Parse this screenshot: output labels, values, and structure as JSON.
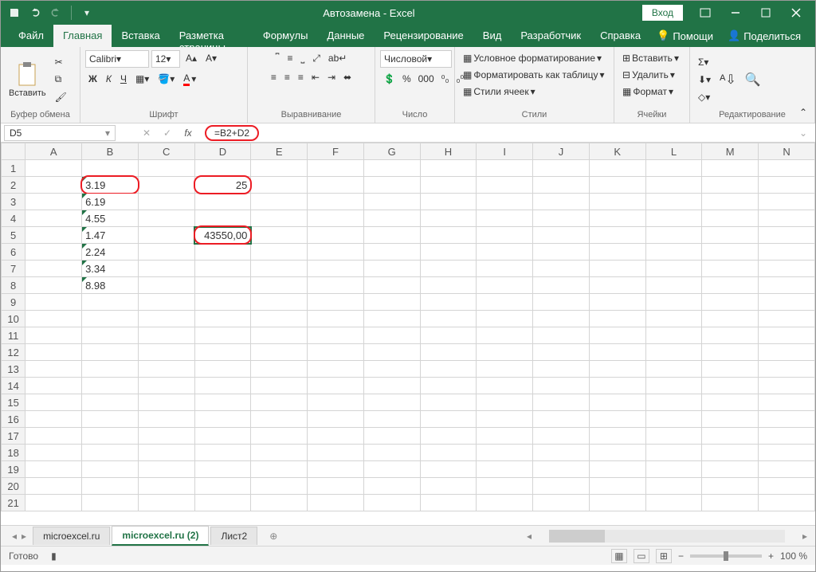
{
  "titlebar": {
    "title": "Автозамена - Excel",
    "signin": "Вход"
  },
  "tabs": {
    "file": "Файл",
    "home": "Главная",
    "insert": "Вставка",
    "layout": "Разметка страницы",
    "formulas": "Формулы",
    "data": "Данные",
    "review": "Рецензирование",
    "view": "Вид",
    "developer": "Разработчик",
    "help": "Справка",
    "tellme": "Помощи",
    "share": "Поделиться"
  },
  "ribbon": {
    "clipboard": {
      "label": "Буфер обмена",
      "paste": "Вставить"
    },
    "font": {
      "label": "Шрифт",
      "name": "Calibri",
      "size": "12",
      "bold": "Ж",
      "italic": "К",
      "underline": "Ч"
    },
    "align": {
      "label": "Выравнивание"
    },
    "number": {
      "label": "Число",
      "format": "Числовой"
    },
    "styles": {
      "label": "Стили",
      "cond": "Условное форматирование",
      "table": "Форматировать как таблицу",
      "cell": "Стили ячеек"
    },
    "cells": {
      "label": "Ячейки",
      "insert": "Вставить",
      "delete": "Удалить",
      "format": "Формат"
    },
    "editing": {
      "label": "Редактирование"
    }
  },
  "formula_bar": {
    "cell_ref": "D5",
    "formula": "=B2+D2"
  },
  "grid": {
    "columns": [
      "A",
      "B",
      "C",
      "D",
      "E",
      "F",
      "G",
      "H",
      "I",
      "J",
      "K",
      "L",
      "M",
      "N"
    ],
    "rows": [
      1,
      2,
      3,
      4,
      5,
      6,
      7,
      8,
      9,
      10,
      11,
      12,
      13,
      14,
      15,
      16,
      17,
      18,
      19,
      20,
      21
    ],
    "cells": {
      "B2": "3.19",
      "B3": "6.19",
      "B4": "4.55",
      "B5": "1.47",
      "B6": "2.24",
      "B7": "3.34",
      "B8": "8.98",
      "D2": "25",
      "D5": "43550,00"
    }
  },
  "sheets": {
    "s1": "microexcel.ru",
    "s2": "microexcel.ru (2)",
    "s3": "Лист2"
  },
  "status": {
    "ready": "Готово",
    "zoom": "100 %"
  }
}
